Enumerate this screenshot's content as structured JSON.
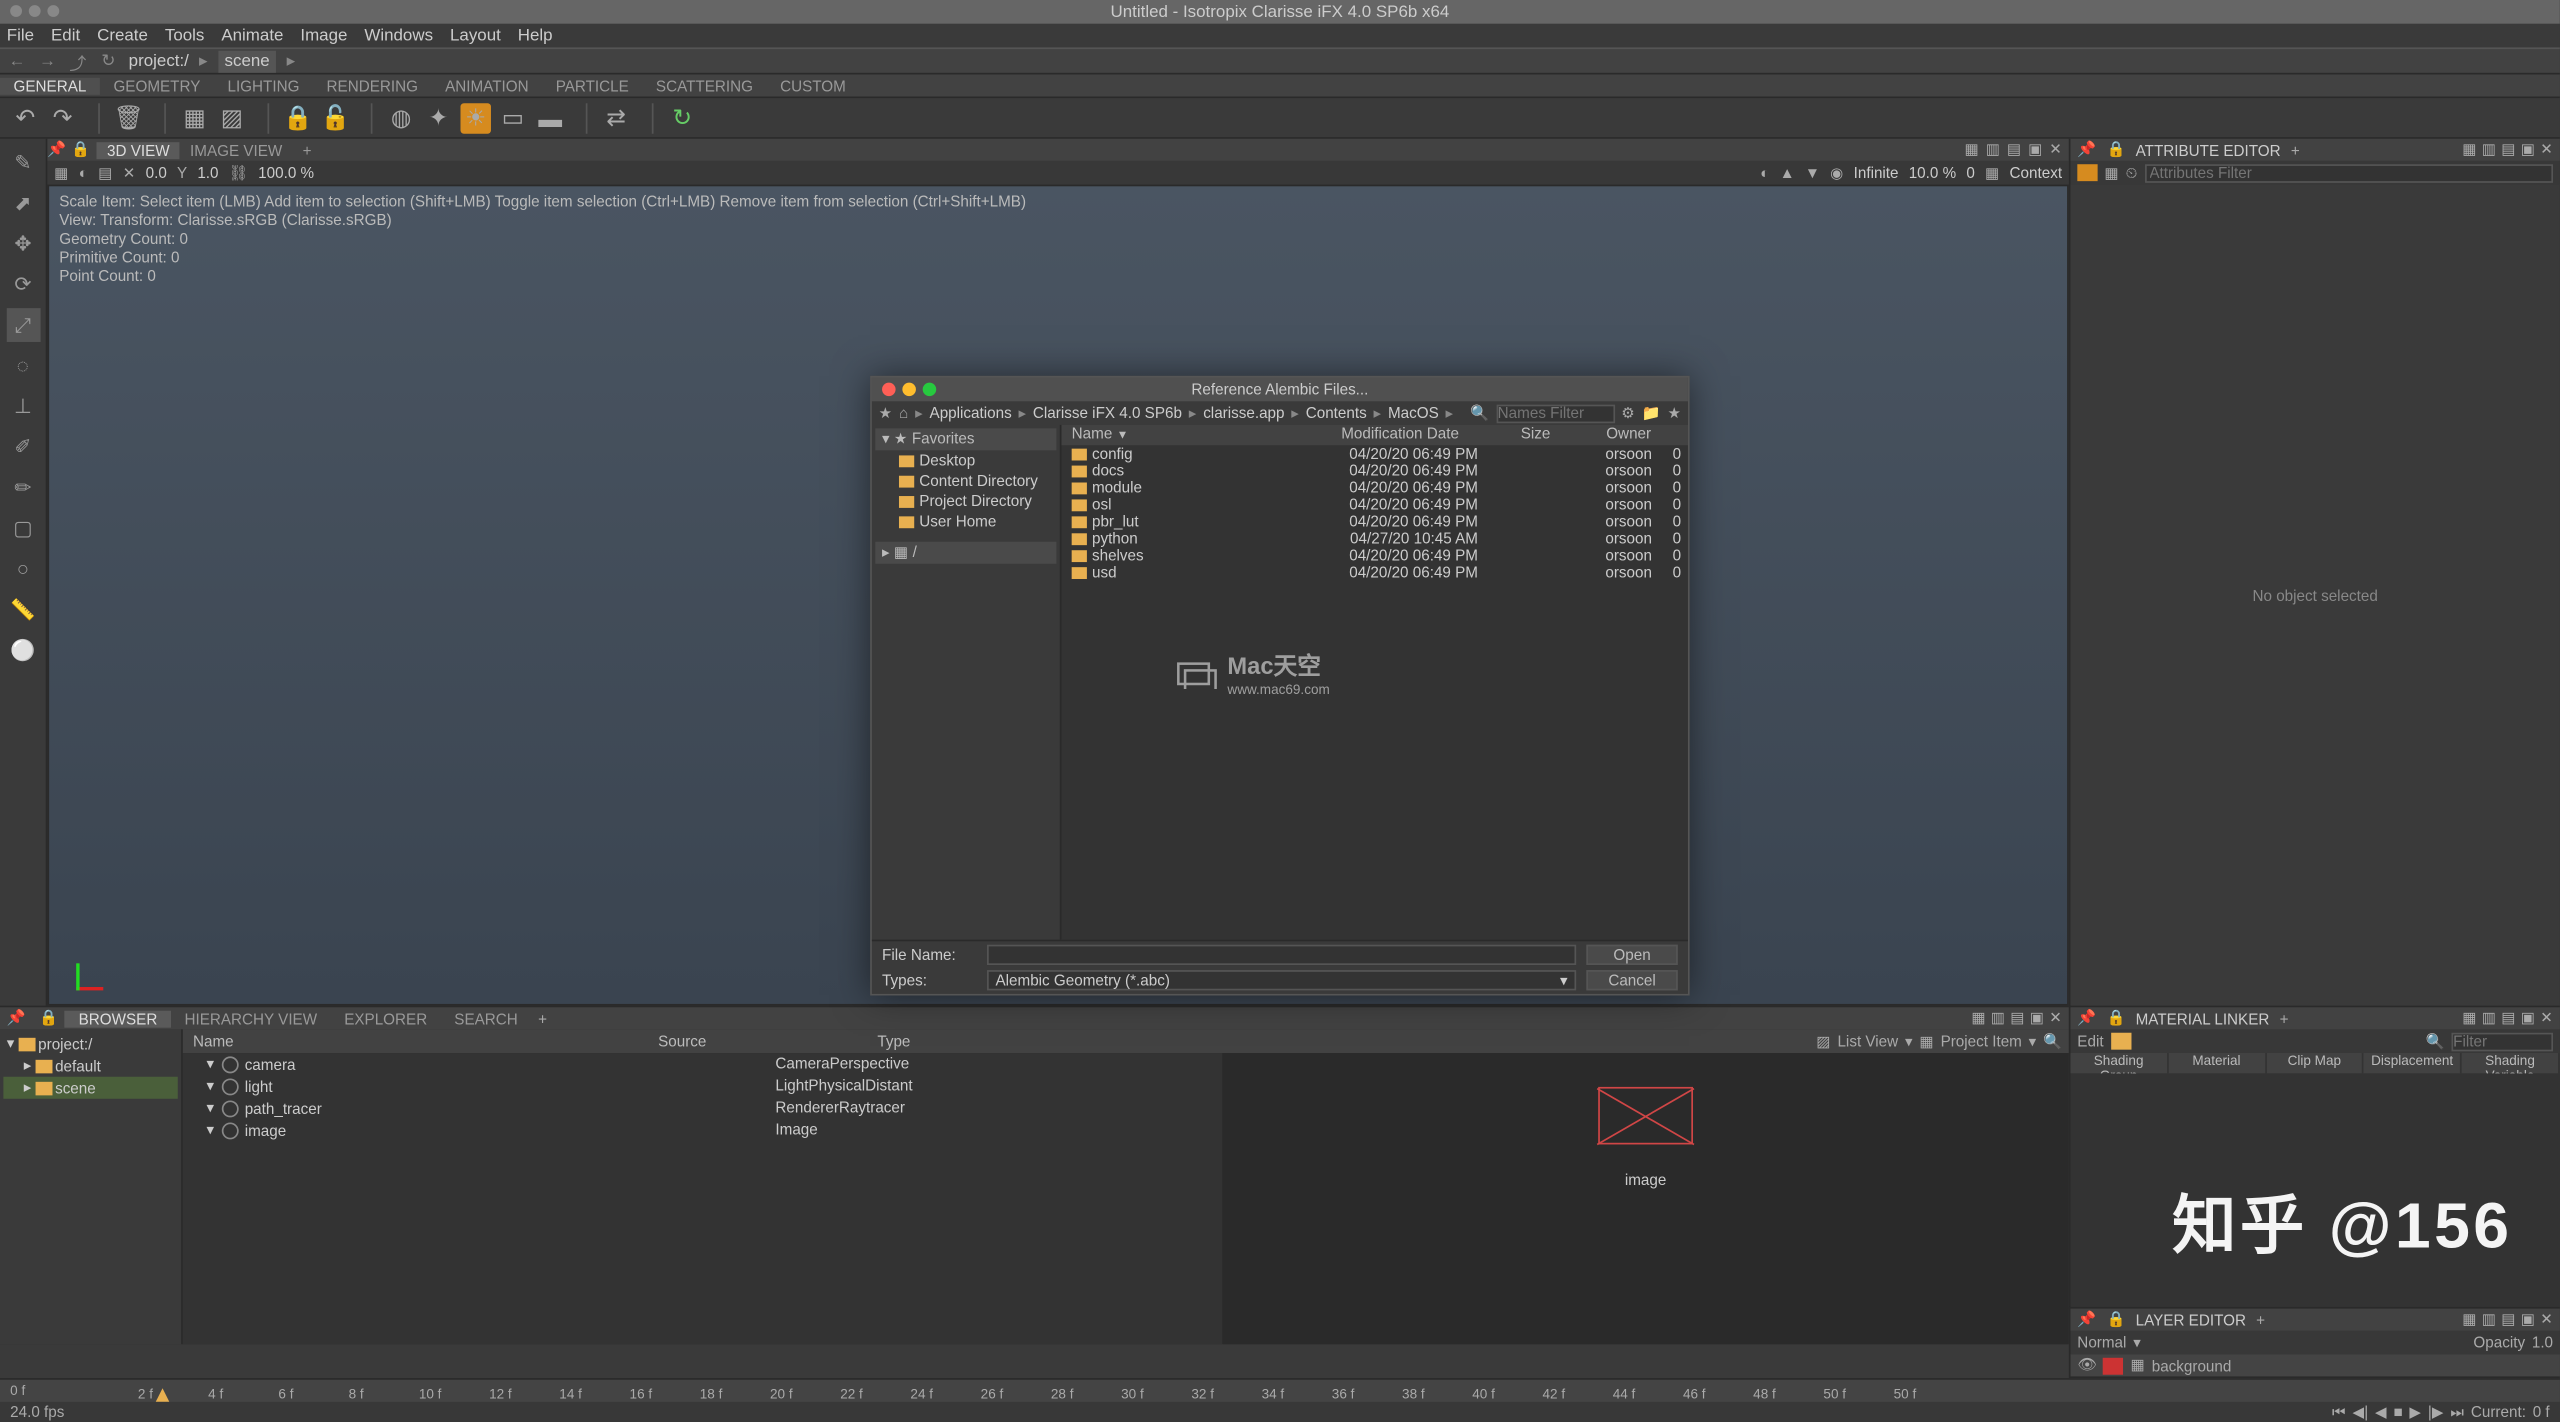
{
  "os_title": "Untitled - Isotropix Clarisse iFX 4.0 SP6b x64",
  "menubar": [
    "File",
    "Edit",
    "Create",
    "Tools",
    "Animate",
    "Image",
    "Windows",
    "Layout",
    "Help"
  ],
  "breadcrumb": {
    "project": "project:/",
    "scene": "scene"
  },
  "tabs": [
    "GENERAL",
    "GEOMETRY",
    "LIGHTING",
    "RENDERING",
    "ANIMATION",
    "PARTICLE",
    "SCATTERING",
    "CUSTOM"
  ],
  "viewport_tabs": [
    "3D VIEW",
    "IMAGE VIEW"
  ],
  "viewport_subbar": {
    "val1": "0.0",
    "val2": "1.0",
    "pct": "100.0 %",
    "r_infinite": "Infinite",
    "r_pct": "10.0 %",
    "r_zero": "0",
    "r_context": "Context"
  },
  "viewport_info": [
    "Scale Item: Select item (LMB)   Add item to selection (Shift+LMB)   Toggle item selection (Ctrl+LMB)   Remove item from selection (Ctrl+Shift+LMB)",
    "View: Transform: Clarisse.sRGB (Clarisse.sRGB)",
    "Geometry Count: 0",
    "Primitive Count: 0",
    "Point Count: 0"
  ],
  "right_panels": {
    "attribute_editor": {
      "title": "ATTRIBUTE EDITOR",
      "search_ph": "Attributes Filter",
      "empty": "No object selected"
    },
    "material_linker": {
      "title": "MATERIAL LINKER",
      "edit": "Edit",
      "filter_ph": "Filter",
      "cols": [
        "Shading Group",
        "Material",
        "Clip Map",
        "Displacement",
        "Shading Variable"
      ]
    },
    "layer_editor": {
      "title": "LAYER EDITOR",
      "mode": "Normal",
      "opacity_lbl": "Opacity",
      "opacity_val": "1.0",
      "layer": "background"
    }
  },
  "browser": {
    "tabs": [
      "BROWSER",
      "HIERARCHY VIEW",
      "EXPLORER",
      "SEARCH"
    ],
    "tree": [
      {
        "label": "project:/",
        "indent": 0
      },
      {
        "label": "default",
        "indent": 1
      },
      {
        "label": "scene",
        "indent": 1,
        "sel": true
      }
    ],
    "list_view": "List View",
    "project_item": "Project Item",
    "cols": [
      "Name",
      "Source",
      "Type"
    ],
    "rows": [
      {
        "name": "camera",
        "type": "CameraPerspective"
      },
      {
        "name": "light",
        "type": "LightPhysicalDistant"
      },
      {
        "name": "path_tracer",
        "type": "RendererRaytracer"
      },
      {
        "name": "image",
        "type": "Image"
      }
    ],
    "preview_label": "image"
  },
  "dialog": {
    "title": "Reference Alembic Files...",
    "crumb": [
      "Applications",
      "Clarisse iFX 4.0 SP6b",
      "clarisse.app",
      "Contents",
      "MacOS"
    ],
    "search_ph": "Names Filter",
    "favorites_label": "Favorites",
    "favorites": [
      "Desktop",
      "Content Directory",
      "Project Directory",
      "User Home"
    ],
    "root_row": "/",
    "cols": {
      "name": "Name",
      "date": "Modification Date",
      "size": "Size",
      "owner": "Owner"
    },
    "rows": [
      {
        "name": "config",
        "date": "04/20/20  06:49 PM",
        "owner": "orsoon",
        "z": "0"
      },
      {
        "name": "docs",
        "date": "04/20/20  06:49 PM",
        "owner": "orsoon",
        "z": "0"
      },
      {
        "name": "module",
        "date": "04/20/20  06:49 PM",
        "owner": "orsoon",
        "z": "0"
      },
      {
        "name": "osl",
        "date": "04/20/20  06:49 PM",
        "owner": "orsoon",
        "z": "0"
      },
      {
        "name": "pbr_lut",
        "date": "04/20/20  06:49 PM",
        "owner": "orsoon",
        "z": "0"
      },
      {
        "name": "python",
        "date": "04/27/20  10:45 AM",
        "owner": "orsoon",
        "z": "0"
      },
      {
        "name": "shelves",
        "date": "04/20/20  06:49 PM",
        "owner": "orsoon",
        "z": "0"
      },
      {
        "name": "usd",
        "date": "04/20/20  06:49 PM",
        "owner": "orsoon",
        "z": "0"
      }
    ],
    "filename_lbl": "File Name:",
    "types_lbl": "Types:",
    "types_val": "Alembic Geometry (*.abc)",
    "open": "Open",
    "cancel": "Cancel",
    "watermark": {
      "title": "Mac天空",
      "sub": "www.mac69.com"
    }
  },
  "timeline": {
    "start": "0 f",
    "marks": [
      "2 f",
      "4 f",
      "6 f",
      "8 f",
      "10 f",
      "12 f",
      "14 f",
      "16 f",
      "18 f",
      "20 f",
      "22 f",
      "24 f",
      "26 f",
      "28 f",
      "30 f",
      "32 f",
      "34 f",
      "36 f",
      "38 f",
      "40 f",
      "42 f",
      "44 f",
      "46 f",
      "48 f",
      "50 f",
      "50 f"
    ],
    "fps": "24.0 fps",
    "current_lbl": "Current:",
    "current_val": "0 f"
  },
  "zh_watermark": "知乎 @156"
}
